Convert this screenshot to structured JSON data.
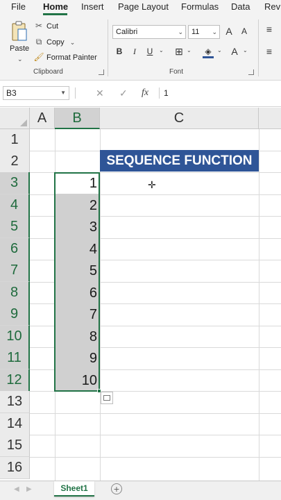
{
  "ribbon_tabs": [
    "File",
    "Home",
    "Insert",
    "Page Layout",
    "Formulas",
    "Data",
    "Revi"
  ],
  "active_tab": "Home",
  "clipboard": {
    "paste_label": "Paste",
    "cut_label": "Cut",
    "copy_label": "Copy",
    "format_painter_label": "Format Painter",
    "group_label": "Clipboard"
  },
  "font": {
    "name": "Calibri",
    "size": "11",
    "grow_label": "A",
    "shrink_label": "A",
    "bold": "B",
    "italic": "I",
    "underline": "U",
    "font_color_label": "A",
    "group_label": "Font"
  },
  "formula_bar": {
    "name_box": "B3",
    "cancel_glyph": "✕",
    "enter_glyph": "✓",
    "fx_label": "fx",
    "formula": "1"
  },
  "columns": [
    "A",
    "B",
    "C"
  ],
  "selected_column": "B",
  "rows": [
    "1",
    "2",
    "3",
    "4",
    "5",
    "6",
    "7",
    "8",
    "9",
    "10",
    "11",
    "12",
    "13",
    "14",
    "15",
    "16"
  ],
  "selected_rows": [
    "3",
    "4",
    "5",
    "6",
    "7",
    "8",
    "9",
    "10",
    "11",
    "12"
  ],
  "cells": {
    "C2": "SEQUENCE FUNCTION",
    "B_values": [
      "1",
      "2",
      "3",
      "4",
      "5",
      "6",
      "7",
      "8",
      "9",
      "10"
    ]
  },
  "colors": {
    "accent": "#217346",
    "title_fill": "#2f5597",
    "selection_fill": "#d0d0d0"
  },
  "sheet_tab": "Sheet1",
  "icons": [
    "paste-icon",
    "cut-icon",
    "copy-icon",
    "format-painter-icon",
    "borders-icon",
    "fill-color-icon",
    "align-icon",
    "quick-analysis-icon",
    "cell-cursor-icon",
    "add-sheet-icon"
  ]
}
